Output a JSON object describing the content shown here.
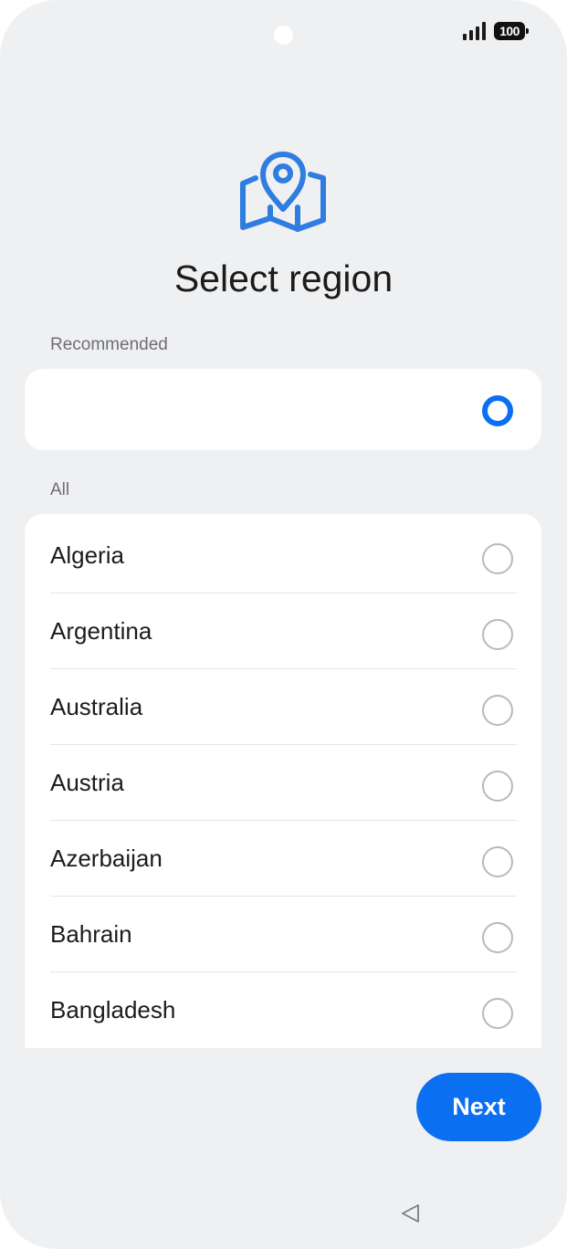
{
  "status_bar": {
    "battery": "100",
    "icons": [
      "signal-icon",
      "battery-icon"
    ]
  },
  "header": {
    "icon": "map-pin-icon",
    "title": "Select region"
  },
  "recommended": {
    "label": "Recommended",
    "selected": true,
    "value": ""
  },
  "all": {
    "label": "All",
    "items": [
      {
        "label": "Algeria",
        "selected": false
      },
      {
        "label": "Argentina",
        "selected": false
      },
      {
        "label": "Australia",
        "selected": false
      },
      {
        "label": "Austria",
        "selected": false
      },
      {
        "label": "Azerbaijan",
        "selected": false
      },
      {
        "label": "Bahrain",
        "selected": false
      },
      {
        "label": "Bangladesh",
        "selected": false
      }
    ]
  },
  "footer": {
    "next_label": "Next"
  },
  "nav_bar": {
    "icons": [
      "back-icon"
    ]
  },
  "colors": {
    "accent": "#0b6ff2",
    "background": "#eff0f2",
    "card": "#ffffff",
    "icon_blue": "#2f7de0"
  }
}
